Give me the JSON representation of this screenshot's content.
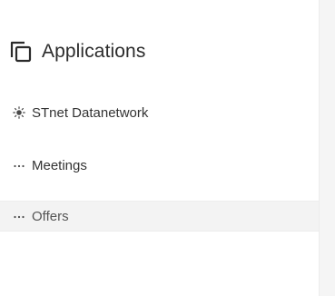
{
  "header": {
    "title": "Applications",
    "icon": "copy-icon"
  },
  "nav": {
    "items": [
      {
        "label": "STnet Datanetwork",
        "icon": "sun-icon",
        "active": false
      },
      {
        "label": "Meetings",
        "icon": "ellipsis-icon",
        "active": false
      },
      {
        "label": "Offers",
        "icon": "ellipsis-icon",
        "active": true
      }
    ]
  },
  "colors": {
    "text": "#333333",
    "title": "#2b2b2b",
    "active_bg": "#f3f3f3",
    "panel_bg": "#f5f5f5"
  }
}
